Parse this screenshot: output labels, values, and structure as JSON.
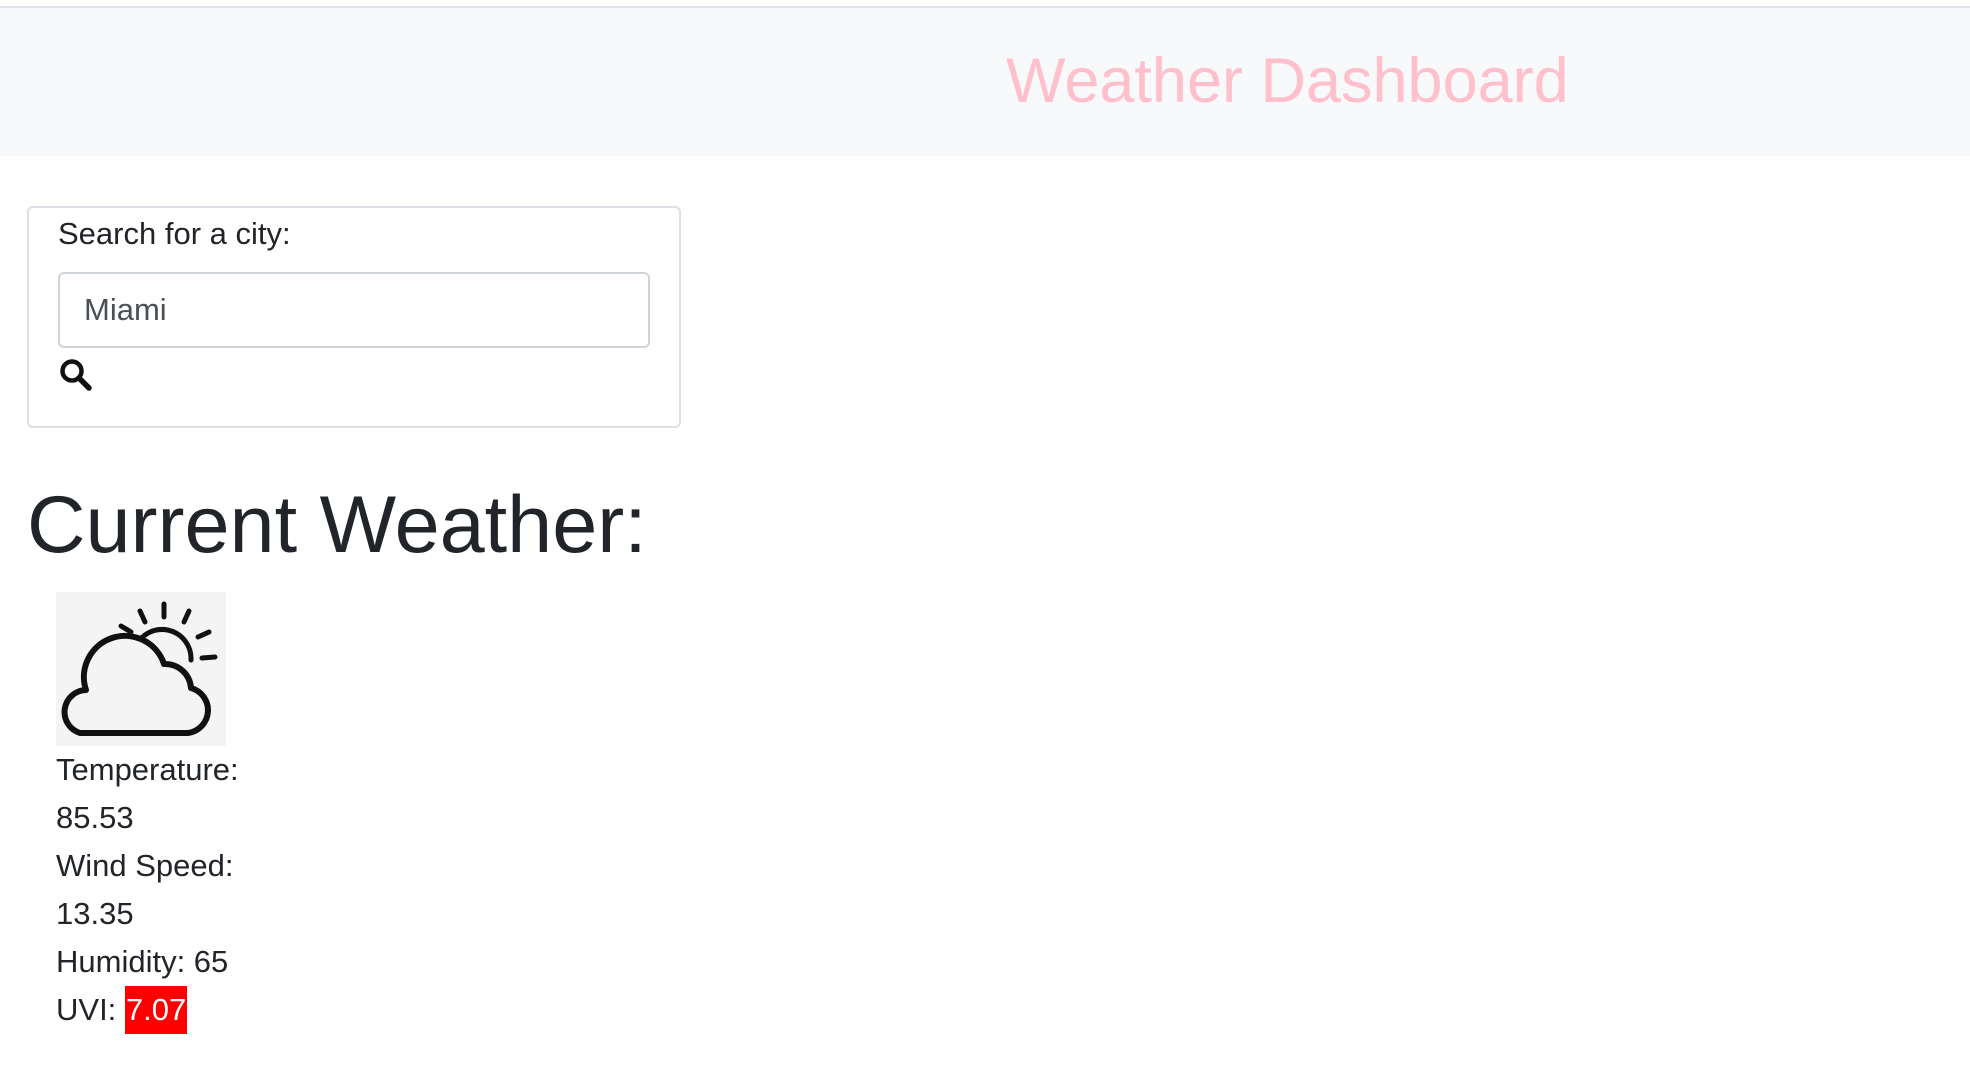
{
  "header": {
    "title": "Weather Dashboard",
    "title_color": "#ffc0cb"
  },
  "search": {
    "label": "Search for a city:",
    "value": "Miami",
    "button_icon": "search-icon"
  },
  "current": {
    "heading": "Current Weather:",
    "icon": "partly-cloudy-icon",
    "temperature_label": "Temperature:",
    "temperature_value": "85.53",
    "wind_label": "Wind Speed:",
    "wind_value": "13.35",
    "humidity_text": "Humidity: 65",
    "uvi_label": "UVI:",
    "uvi_value": "7.07",
    "uvi_color": "#ff0000"
  }
}
